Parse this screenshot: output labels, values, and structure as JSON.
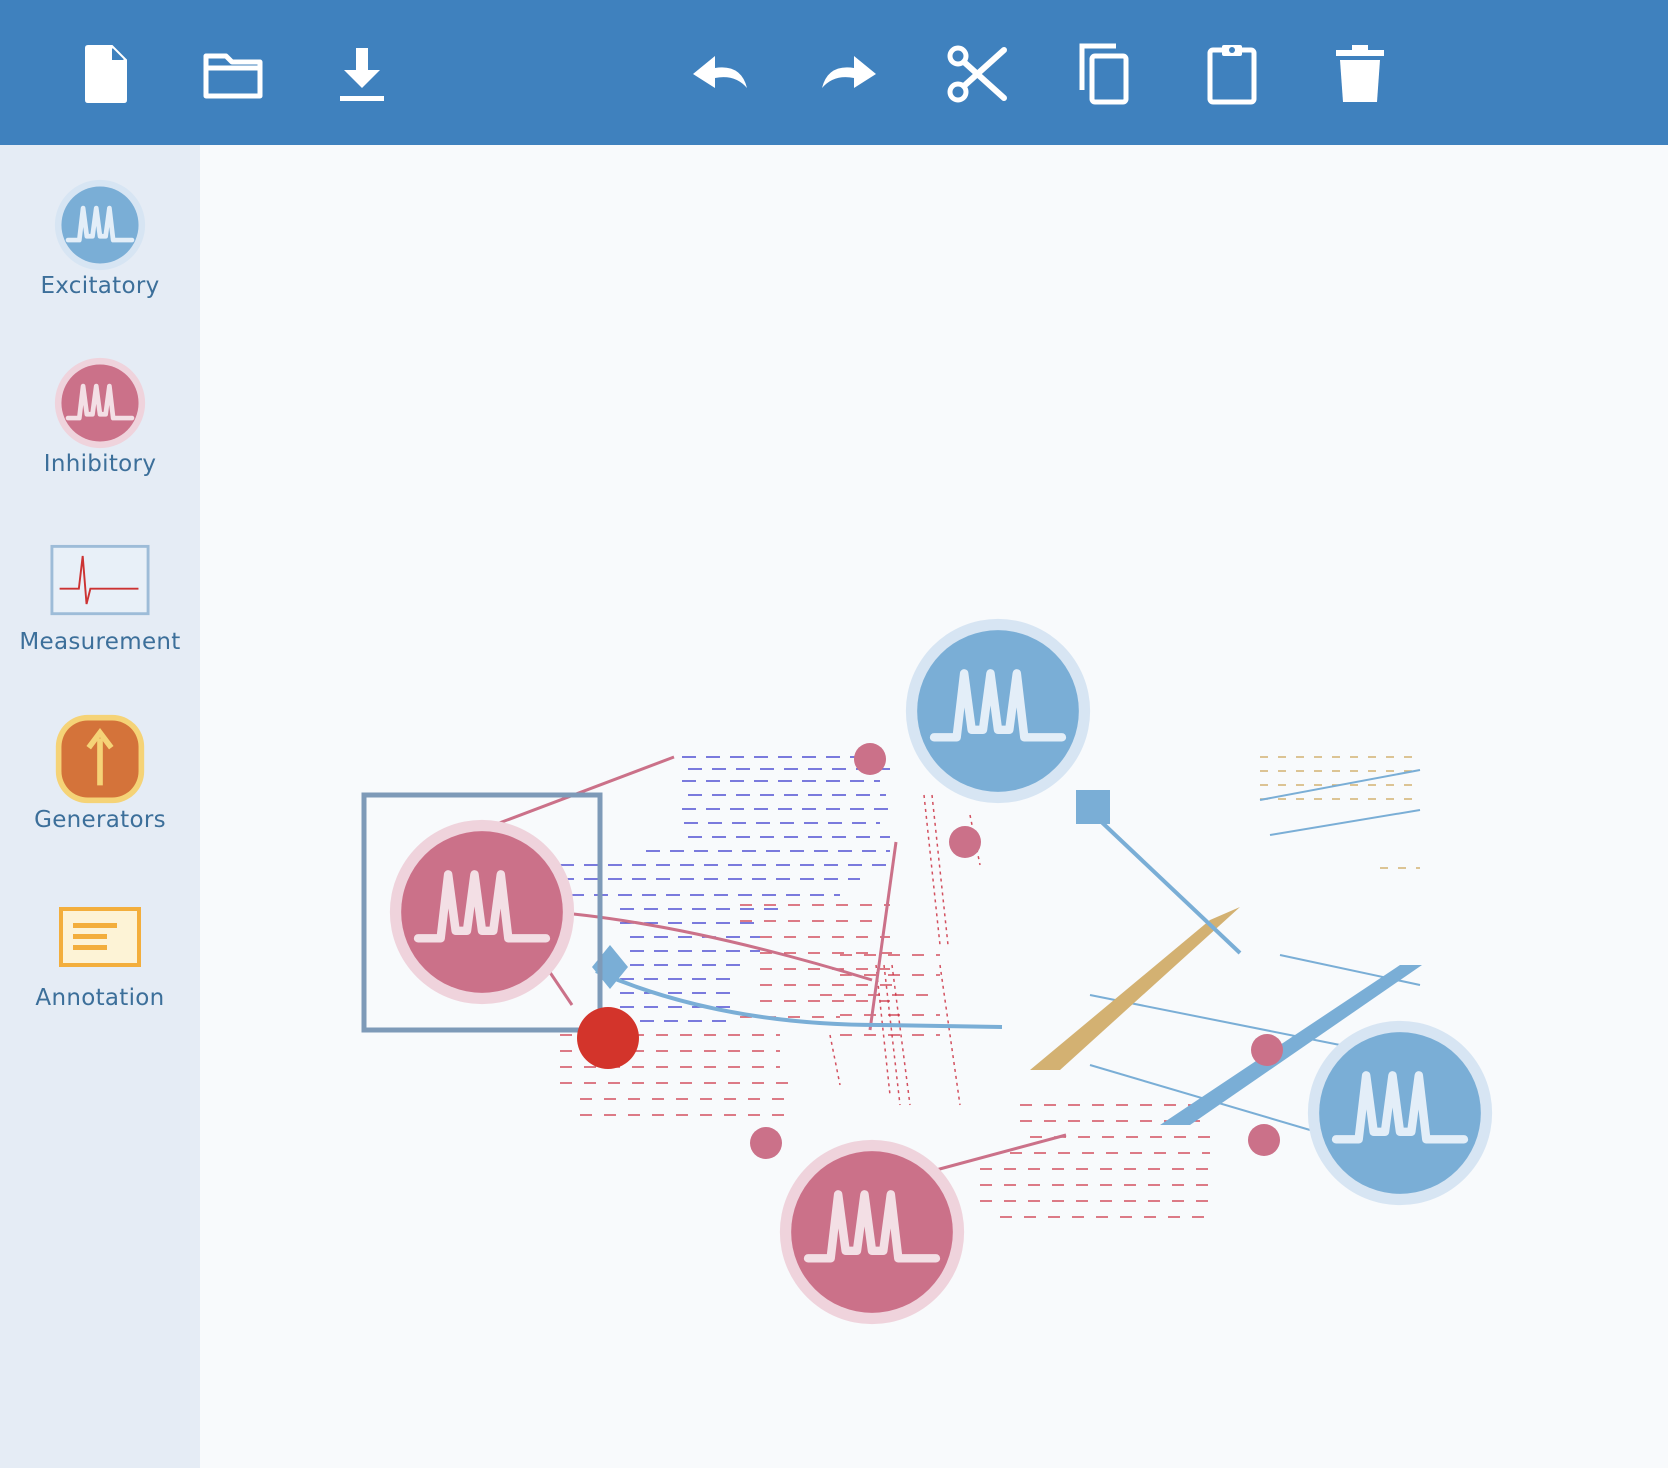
{
  "toolbar": {
    "buttons": [
      {
        "name": "new-file",
        "icon": "file-icon"
      },
      {
        "name": "open-folder",
        "icon": "folder-icon"
      },
      {
        "name": "download",
        "icon": "download-icon"
      },
      {
        "name": "undo",
        "icon": "undo-icon"
      },
      {
        "name": "redo",
        "icon": "redo-icon"
      },
      {
        "name": "cut",
        "icon": "scissors-icon"
      },
      {
        "name": "copy",
        "icon": "copy-icon"
      },
      {
        "name": "paste",
        "icon": "clipboard-icon"
      },
      {
        "name": "delete",
        "icon": "trash-icon"
      }
    ]
  },
  "palette": {
    "items": [
      {
        "label": "Excitatory",
        "icon": "excitatory-neuron-icon"
      },
      {
        "label": "Inhibitory",
        "icon": "inhibitory-neuron-icon"
      },
      {
        "label": "Measurement",
        "icon": "measurement-icon"
      },
      {
        "label": "Generators",
        "icon": "generator-icon"
      },
      {
        "label": "Annotation",
        "icon": "annotation-icon"
      }
    ]
  },
  "colors": {
    "toolbar": "#3f81be",
    "sidebar": "#e5ecf5",
    "canvas": "#f8fafc",
    "excitatory": "#7aaed6",
    "excitatory_ring": "#d7e5f3",
    "inhibitory": "#cb7189",
    "inhibitory_ring": "#efd3dc",
    "generator": "#d4733a",
    "generator_ring": "#f5d377",
    "annotation_border": "#f3ae3c",
    "annotation_fill": "#fdf3d6",
    "measurement_border": "#9dbcd8",
    "trace": "#cc3333",
    "selected_node": "#d3342b",
    "selection_box": "#7e9ab8",
    "synapse_tan": "#d3b172"
  }
}
